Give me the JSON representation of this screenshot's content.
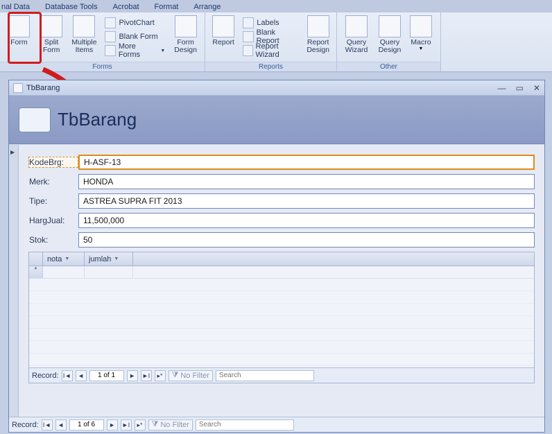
{
  "menu": {
    "items": [
      "nal Data",
      "Database Tools",
      "Acrobat",
      "Format",
      "Arrange"
    ]
  },
  "ribbon": {
    "forms": {
      "label": "Forms",
      "form": "Form",
      "split": "Split\nForm",
      "multi": "Multiple\nItems",
      "pivot": "PivotChart",
      "blank": "Blank Form",
      "more": "More Forms",
      "design": "Form\nDesign"
    },
    "reports": {
      "label": "Reports",
      "report": "Report",
      "labels": "Labels",
      "blank": "Blank Report",
      "wizard": "Report Wizard",
      "design": "Report\nDesign"
    },
    "other": {
      "label": "Other",
      "qwiz": "Query\nWizard",
      "qdes": "Query\nDesign",
      "macro": "Macro"
    }
  },
  "window": {
    "tab_title": "TbBarang",
    "header_title": "TbBarang"
  },
  "fields": {
    "kodebrg": {
      "label": "KodeBrg:",
      "value": "H-ASF-13"
    },
    "merk": {
      "label": "Merk:",
      "value": "HONDA"
    },
    "tipe": {
      "label": "Tipe:",
      "value": "ASTREA SUPRA FIT 2013"
    },
    "hargjual": {
      "label": "HargJual:",
      "value": "11,500,000"
    },
    "stok": {
      "label": "Stok:",
      "value": "50"
    }
  },
  "subform": {
    "cols": {
      "nota": "nota",
      "jumlah": "jumlah"
    },
    "nav": {
      "label": "Record:",
      "pos": "1 of 1",
      "nofilter": "No Filter",
      "search": "Search"
    }
  },
  "nav": {
    "label": "Record:",
    "pos": "1 of 6",
    "nofilter": "No Filter",
    "search": "Search"
  }
}
